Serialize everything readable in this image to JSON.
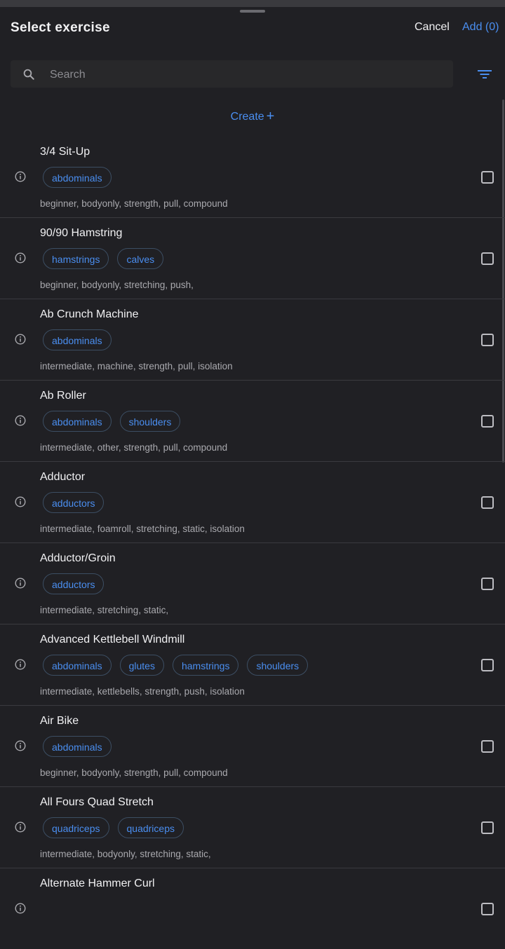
{
  "header": {
    "title": "Select exercise",
    "cancel_label": "Cancel",
    "add_label": "Add (0)"
  },
  "search": {
    "placeholder": "Search",
    "value": ""
  },
  "create_label": "Create",
  "colors": {
    "background": "#202024",
    "accent": "#4a8ef0",
    "chip_border": "#3c4e63",
    "muted_text": "#a9a9ae"
  },
  "icons": {
    "search": "search-icon",
    "filter": "filter-icon",
    "info": "info-icon",
    "create": "plus-icon"
  },
  "exercises": [
    {
      "name": "3/4 Sit-Up",
      "muscles": [
        "abdominals"
      ],
      "tags": "beginner, bodyonly, strength, pull, compound",
      "selected": false
    },
    {
      "name": "90/90 Hamstring",
      "muscles": [
        "hamstrings",
        "calves"
      ],
      "tags": "beginner, bodyonly, stretching, push,",
      "selected": false
    },
    {
      "name": "Ab Crunch Machine",
      "muscles": [
        "abdominals"
      ],
      "tags": "intermediate, machine, strength, pull, isolation",
      "selected": false
    },
    {
      "name": "Ab Roller",
      "muscles": [
        "abdominals",
        "shoulders"
      ],
      "tags": "intermediate, other, strength, pull, compound",
      "selected": false
    },
    {
      "name": "Adductor",
      "muscles": [
        "adductors"
      ],
      "tags": "intermediate, foamroll, stretching, static, isolation",
      "selected": false
    },
    {
      "name": "Adductor/Groin",
      "muscles": [
        "adductors"
      ],
      "tags": "intermediate, stretching, static,",
      "selected": false
    },
    {
      "name": "Advanced Kettlebell Windmill",
      "muscles": [
        "abdominals",
        "glutes",
        "hamstrings",
        "shoulders"
      ],
      "tags": "intermediate, kettlebells, strength, push, isolation",
      "selected": false
    },
    {
      "name": "Air Bike",
      "muscles": [
        "abdominals"
      ],
      "tags": "beginner, bodyonly, strength, pull, compound",
      "selected": false
    },
    {
      "name": "All Fours Quad Stretch",
      "muscles": [
        "quadriceps",
        "quadriceps"
      ],
      "tags": "intermediate, bodyonly, stretching, static,",
      "selected": false
    },
    {
      "name": "Alternate Hammer Curl",
      "muscles": [],
      "tags": "",
      "selected": false
    }
  ]
}
